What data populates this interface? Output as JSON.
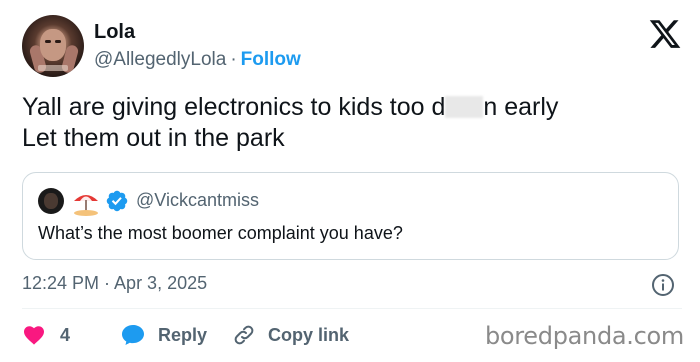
{
  "author": {
    "name": "Lola",
    "handle": "@AllegedlyLola",
    "separator": "·",
    "follow_label": "Follow"
  },
  "tweet": {
    "line1_before": "Yall are giving electronics to kids too d",
    "line1_after": "n early",
    "line2": "Let them out in the park"
  },
  "quoted": {
    "handle": "@Vickcantmiss",
    "text": "What’s the most boomer complaint you have?"
  },
  "timestamp": "12:24 PM · Apr 3, 2025",
  "actions": {
    "like_count": "4",
    "reply_label": "Reply",
    "copy_label": "Copy link"
  },
  "watermark": "boredpanda.com",
  "colors": {
    "accent": "#1d9bf0",
    "heart": "#f91880",
    "muted": "#536471",
    "text": "#0f1419",
    "border": "#cfd9de"
  },
  "icons": [
    "x-logo-icon",
    "umbrella-emoji-icon",
    "verified-badge-icon",
    "info-icon",
    "heart-icon",
    "reply-bubble-icon",
    "link-icon"
  ]
}
